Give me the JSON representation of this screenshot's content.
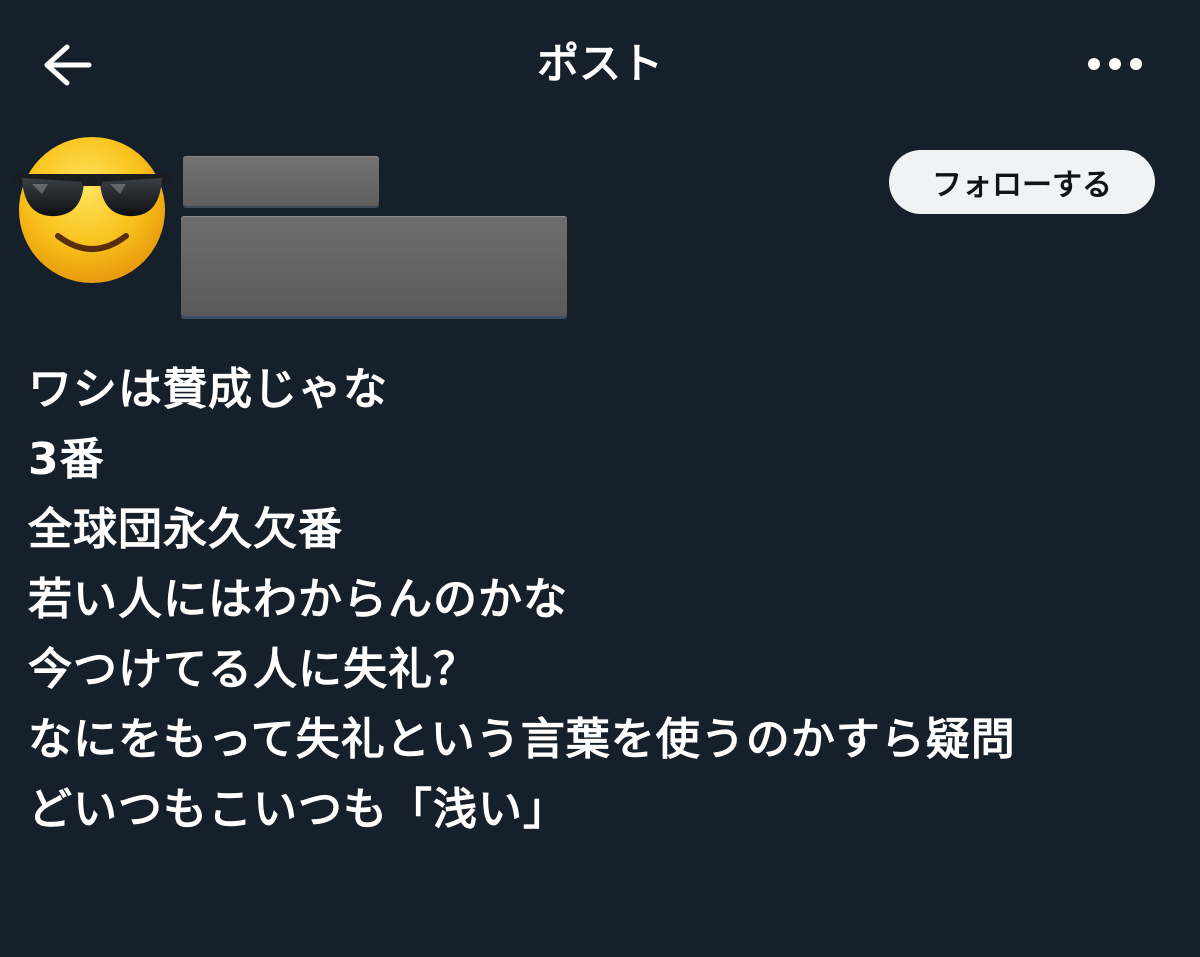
{
  "header": {
    "title": "ポスト",
    "back_icon": "arrow-left-icon",
    "more_icon": "more-horizontal-icon"
  },
  "profile": {
    "avatar_icon": "sunglasses-smiley-avatar"
  },
  "follow_button": {
    "label": "フォローする"
  },
  "post": {
    "lines": [
      "ワシは賛成じゃな",
      "3番",
      "全球団永久欠番",
      "若い人にはわからんのかな",
      "今つけてる人に失礼？",
      "なにをもって失礼という言葉を使うのかすら疑問",
      "どいつもこいつも「浅い」"
    ]
  },
  "colors": {
    "background": "#15202b",
    "text": "#ffffff",
    "follow_button_bg": "#eff3f4",
    "follow_button_text": "#0f1419",
    "redaction": "#666666"
  }
}
